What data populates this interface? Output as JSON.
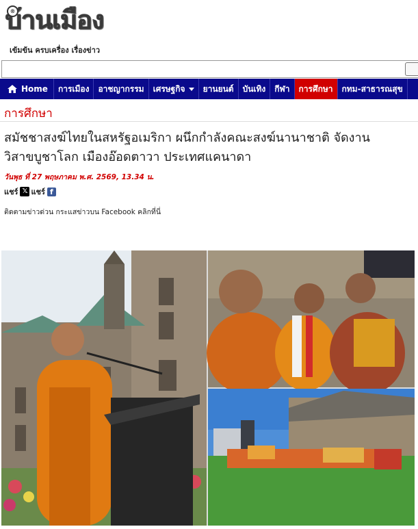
{
  "masthead": {
    "logo_text": "บ้านเมือง",
    "logo_mark": "®",
    "tagline": "เข้มข้น ครบเครื่อง เรื่องข่าว"
  },
  "search": {
    "placeholder": ""
  },
  "nav": {
    "home_label": "Home",
    "items": [
      {
        "label": "การเมือง"
      },
      {
        "label": "อาชญากรรม"
      },
      {
        "label": "เศรษฐกิจ"
      },
      {
        "label": "ยานยนต์"
      },
      {
        "label": "บันเทิง"
      },
      {
        "label": "กีฬา"
      },
      {
        "label": "การศึกษา"
      },
      {
        "label": "กทม-สาธารณสุข"
      }
    ]
  },
  "section": {
    "title": "การศึกษา"
  },
  "article": {
    "headline": "สมัชชาสงฆ์ไทยในสหรัฐอเมริกา ผนึกกำลังคณะสงฆ์นานาชาติ จัดงานวิสาขบูชาโลก เมืองอ๊อดตาวา ประเทศแคนาดา",
    "dateline": "วันพุธ ที่ 27 พฤษภาคม พ.ศ. 2569, 13.34 น.",
    "share_label_1": "แชร์",
    "share_x": "𝕏",
    "share_label_2": "แชร์",
    "share_fb": "f",
    "follow_text": "ติดตามข่าวด่วน กระแสข่าวบน Facebook คลิกที่นี่"
  },
  "colors": {
    "nav_bg": "#0a0a8c",
    "nav_active": "#d10000",
    "section_title": "#d10000",
    "dateline": "#d10000"
  }
}
